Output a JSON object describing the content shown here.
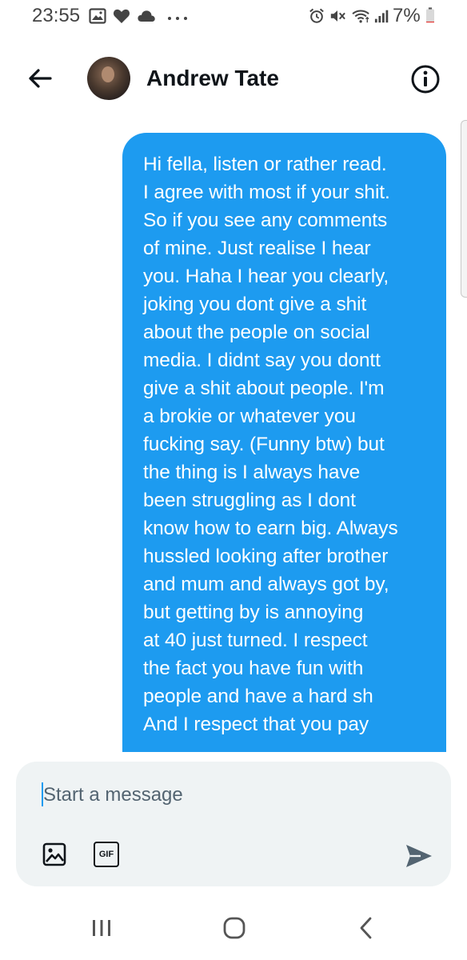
{
  "status_bar": {
    "time": "23:55",
    "battery_percent": "7%",
    "battery_level": 0.07,
    "left_icons": [
      "gallery-icon",
      "heart-icon",
      "cloud-icon",
      "more-dots-icon"
    ],
    "right_icons": [
      "alarm-icon",
      "mute-icon",
      "wifi-icon",
      "signal-icon",
      "battery-icon"
    ]
  },
  "header": {
    "contact_name": "Andrew Tate",
    "back_icon": "arrow-left-icon",
    "info_icon": "info-icon"
  },
  "conversation": {
    "messages": [
      {
        "direction": "outgoing",
        "text": "Hi fella, listen or rather read.\nI agree with most if your shit.\nSo if you see any comments\nof mine. Just realise I hear\nyou. Haha I hear you clearly,\njoking you dont give a shit\nabout the people on social\nmedia. I didnt say you dontt\ngive a shit about people. I'm\na brokie or whatever you\nfucking say. (Funny btw) but\nthe thing is I always have\nbeen struggling as I dont\nknow how to earn big. Always\nhussled looking after brother\nand mum and always got by,\nbut getting by is annoying\nat 40 just turned. I respect\nthe fact you have fun with\npeople and have a hard sh\nAnd I respect that you pay"
      }
    ],
    "scroll_down_icon": "arrow-down-icon"
  },
  "composer": {
    "placeholder": "Start a message",
    "value": "",
    "image_icon": "image-icon",
    "gif_label": "GIF",
    "send_icon": "send-icon"
  },
  "nav_bar": {
    "icons": [
      "recent-apps-icon",
      "home-icon",
      "back-icon"
    ]
  },
  "colors": {
    "accent": "#1d9bf0",
    "bubble_text": "#ffffff",
    "composer_bg": "#eff3f4",
    "title": "#0f1419",
    "secondary": "#536471"
  }
}
